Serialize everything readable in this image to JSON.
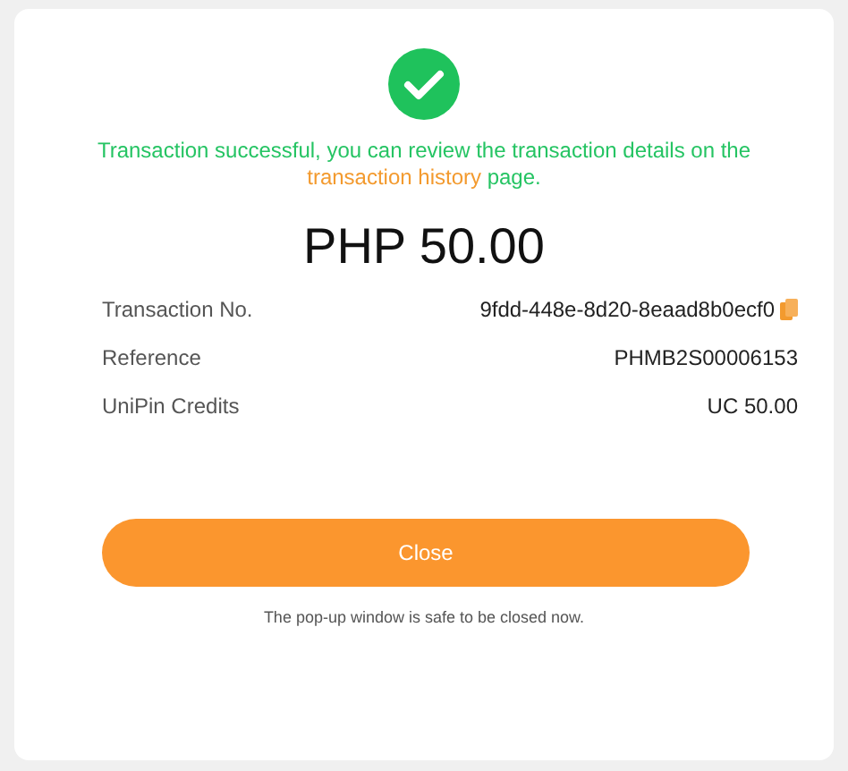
{
  "message": {
    "before": "Transaction successful, you can review the transaction details on the",
    "link": "transaction history",
    "after": "page."
  },
  "amount": "PHP 50.00",
  "details": [
    {
      "label": "Transaction No.",
      "value": "9fdd-448e-8d20-8eaad8b0ecf0",
      "copyable": true
    },
    {
      "label": "Reference",
      "value": "PHMB2S00006153",
      "copyable": false
    },
    {
      "label": "UniPin Credits",
      "value": "UC 50.00",
      "copyable": false
    }
  ],
  "button": "Close",
  "note": "The pop-up window is safe to be closed now."
}
